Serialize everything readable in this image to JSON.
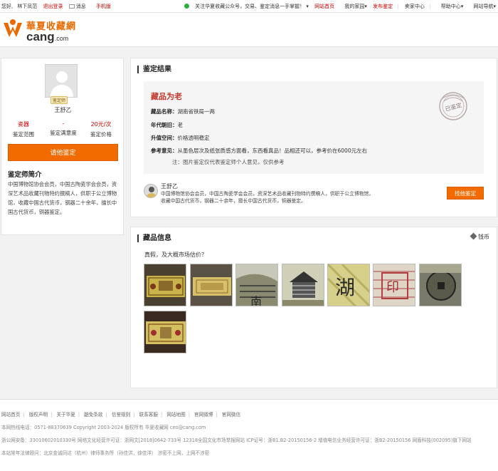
{
  "topbar": {
    "greeting": "您好,",
    "username": "林下凤范",
    "logout": "退出登录",
    "messages": "消息",
    "mobile": "手机版",
    "wechat_notice": "关注华夏收藏公众号，交易、鉴定消息一手掌握！",
    "nav": [
      "网站首页",
      "我的家园",
      "发布鉴定",
      "卖家中心",
      "帮助中心",
      "网站导航"
    ],
    "nav_red_index": [
      0,
      2
    ]
  },
  "logo": {
    "cn": "華夏收藏網",
    "en": "cang",
    "en_suffix": ".com"
  },
  "expert": {
    "badge": "鉴定师",
    "name": "王舒乙",
    "stats": [
      {
        "value": "瓷器",
        "label": "鉴定范围"
      },
      {
        "value": "-",
        "label": "鉴定满意度"
      },
      {
        "value": "20元/次",
        "label": "鉴定价格"
      }
    ],
    "apply_button": "请他鉴定",
    "intro_title": "鉴定师简介",
    "intro_text": "中国博物馆协会会员，中国古陶瓷学会会员，资深艺术品收藏刊物特约撰稿人，供职于公立博物馆，收藏中国古代货币，钢器二十余年，擅长中国古代货币，铜器鉴定。"
  },
  "result": {
    "section_title": "鉴定结果",
    "verdict": "藏品为老",
    "rows": [
      {
        "key": "藏品名称：",
        "value": "湖南省铁局一两"
      },
      {
        "key": "年代朝旧：",
        "value": "老"
      },
      {
        "key": "升值空间：",
        "value": "价格透明稳定"
      },
      {
        "key": "参考意见：",
        "value": "从墨色层次及纸张质感方面看，东西看真品！品相还可以，参考价在6000元左右"
      }
    ],
    "note": "注：图片鉴定仅代表鉴定师个人意见，仅供参考",
    "stamp_text": "已鉴定",
    "comment_name": "王舒乙",
    "comment_text": "中国博物馆协会会员，中国古陶瓷学会会员，资深艺术品收藏刊物特约撰稿人，供职于公立博物馆，收藏中国古代货币，钢器二十余年，擅长中国古代货币，铜器鉴定。",
    "apply_button": "找他鉴定"
  },
  "info": {
    "section_title": "藏品信息",
    "category": "钱币",
    "question": "真假，及大概市场估价？",
    "images": [
      "banknote-front-photo",
      "banknote-back-photo",
      "banknote-corner-closeup",
      "banknote-building-closeup",
      "banknote-character-closeup",
      "banknote-seal-closeup",
      "banknote-coin-closeup",
      "banknote-full-photo"
    ]
  },
  "footer": {
    "links": [
      "网站首页",
      "版权声明",
      "关于华夏",
      "鼬免条款",
      "信誉规则",
      "联系客服",
      "网站地图",
      "官网微博",
      "官网微信"
    ],
    "line1": "本网热线电话：0571-88370639  Copyright 2003-2024 版权所有  华夏收藏网  ceo@cang.com",
    "line2": "浙公网安备：33010602010330号  网络文化经营许可证：浙网文[2018]0642-733号  12318全国文化市场举报网站  ICP证号：浙B1.B2-20150156-2  增值电信业务经营许可证：浙B2-20150156  网盾科技(002095)旗下网站",
    "line3": "本站常年法律顾问：北京金诚同达（杭州）律师事务所（孙佳洪，徐佳洋）  涉密不上网，上网不涉密"
  }
}
